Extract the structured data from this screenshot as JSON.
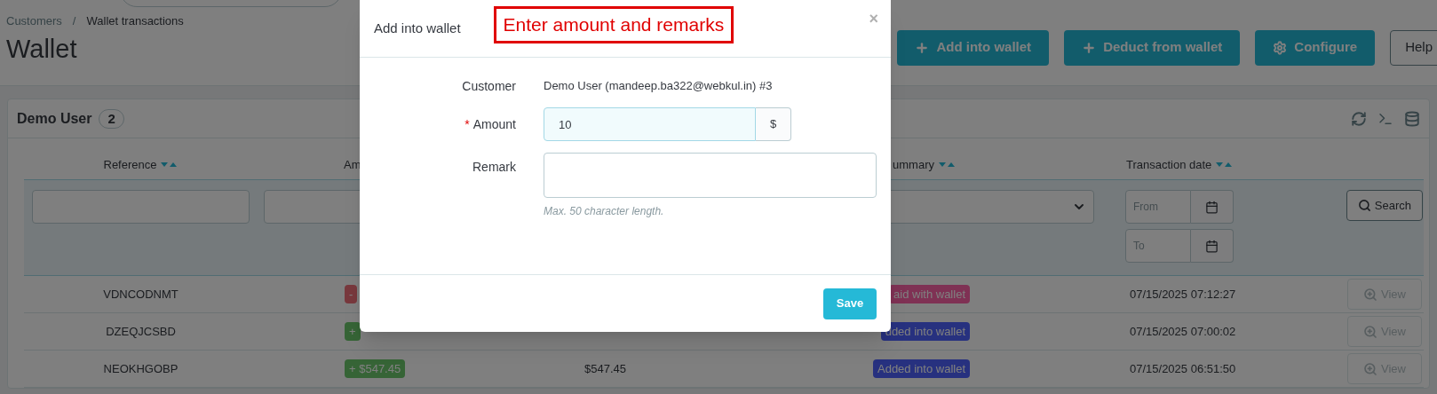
{
  "breadcrumb": {
    "items": [
      "Customers",
      "Wallet transactions"
    ],
    "separator": "/"
  },
  "page_title": "Wallet",
  "toolbar_buttons": [
    {
      "label": "Add into wallet",
      "kind": "add"
    },
    {
      "label": "Deduct from wallet",
      "kind": "deduct"
    },
    {
      "label": "Configure",
      "kind": "configure"
    },
    {
      "label": "Help",
      "kind": "help"
    }
  ],
  "panel": {
    "title": "Demo User",
    "count": "2"
  },
  "columns": [
    {
      "label": "Reference",
      "sortable": true
    },
    {
      "label": "Am"
    },
    {
      "label": "ummary",
      "sortable": true
    },
    {
      "label": "Transaction date",
      "sortable": true
    }
  ],
  "filters": {
    "date_from_placeholder": "From",
    "date_to_placeholder": "To",
    "search_button": "Search"
  },
  "rows": [
    {
      "reference": "VDNCODNMT",
      "amount": {
        "text": "-",
        "kind": "debit"
      },
      "summary": {
        "text": "aid with wallet",
        "kind": "paid"
      },
      "date": "07/15/2025 07:12:27",
      "action": "View"
    },
    {
      "reference": "DZEQJCSBD",
      "amount": {
        "text": "+",
        "kind": "credit"
      },
      "summary": {
        "text": "dded into wallet",
        "kind": "added"
      },
      "date": "07/15/2025 07:00:02",
      "action": "View"
    },
    {
      "reference": "NEOKHGOBP",
      "amount": {
        "text": "+ $547.45",
        "kind": "credit"
      },
      "column_3": "$547.45",
      "summary": {
        "text": "Added into wallet",
        "kind": "added"
      },
      "date": "07/15/2025 06:51:50",
      "action": "View"
    }
  ],
  "modal": {
    "title": "Add into wallet",
    "annotation": "Enter amount and remarks",
    "close": "×",
    "customer_label": "Customer",
    "customer_value": "Demo User (mandeep.ba322@webkul.in) #3",
    "required_mark": "*",
    "amount_label": "Amount",
    "amount_value": "10",
    "amount_focused": true,
    "currency": "$",
    "remark_label": "Remark",
    "remark_help": "Max. 50 character length.",
    "save": "Save"
  }
}
